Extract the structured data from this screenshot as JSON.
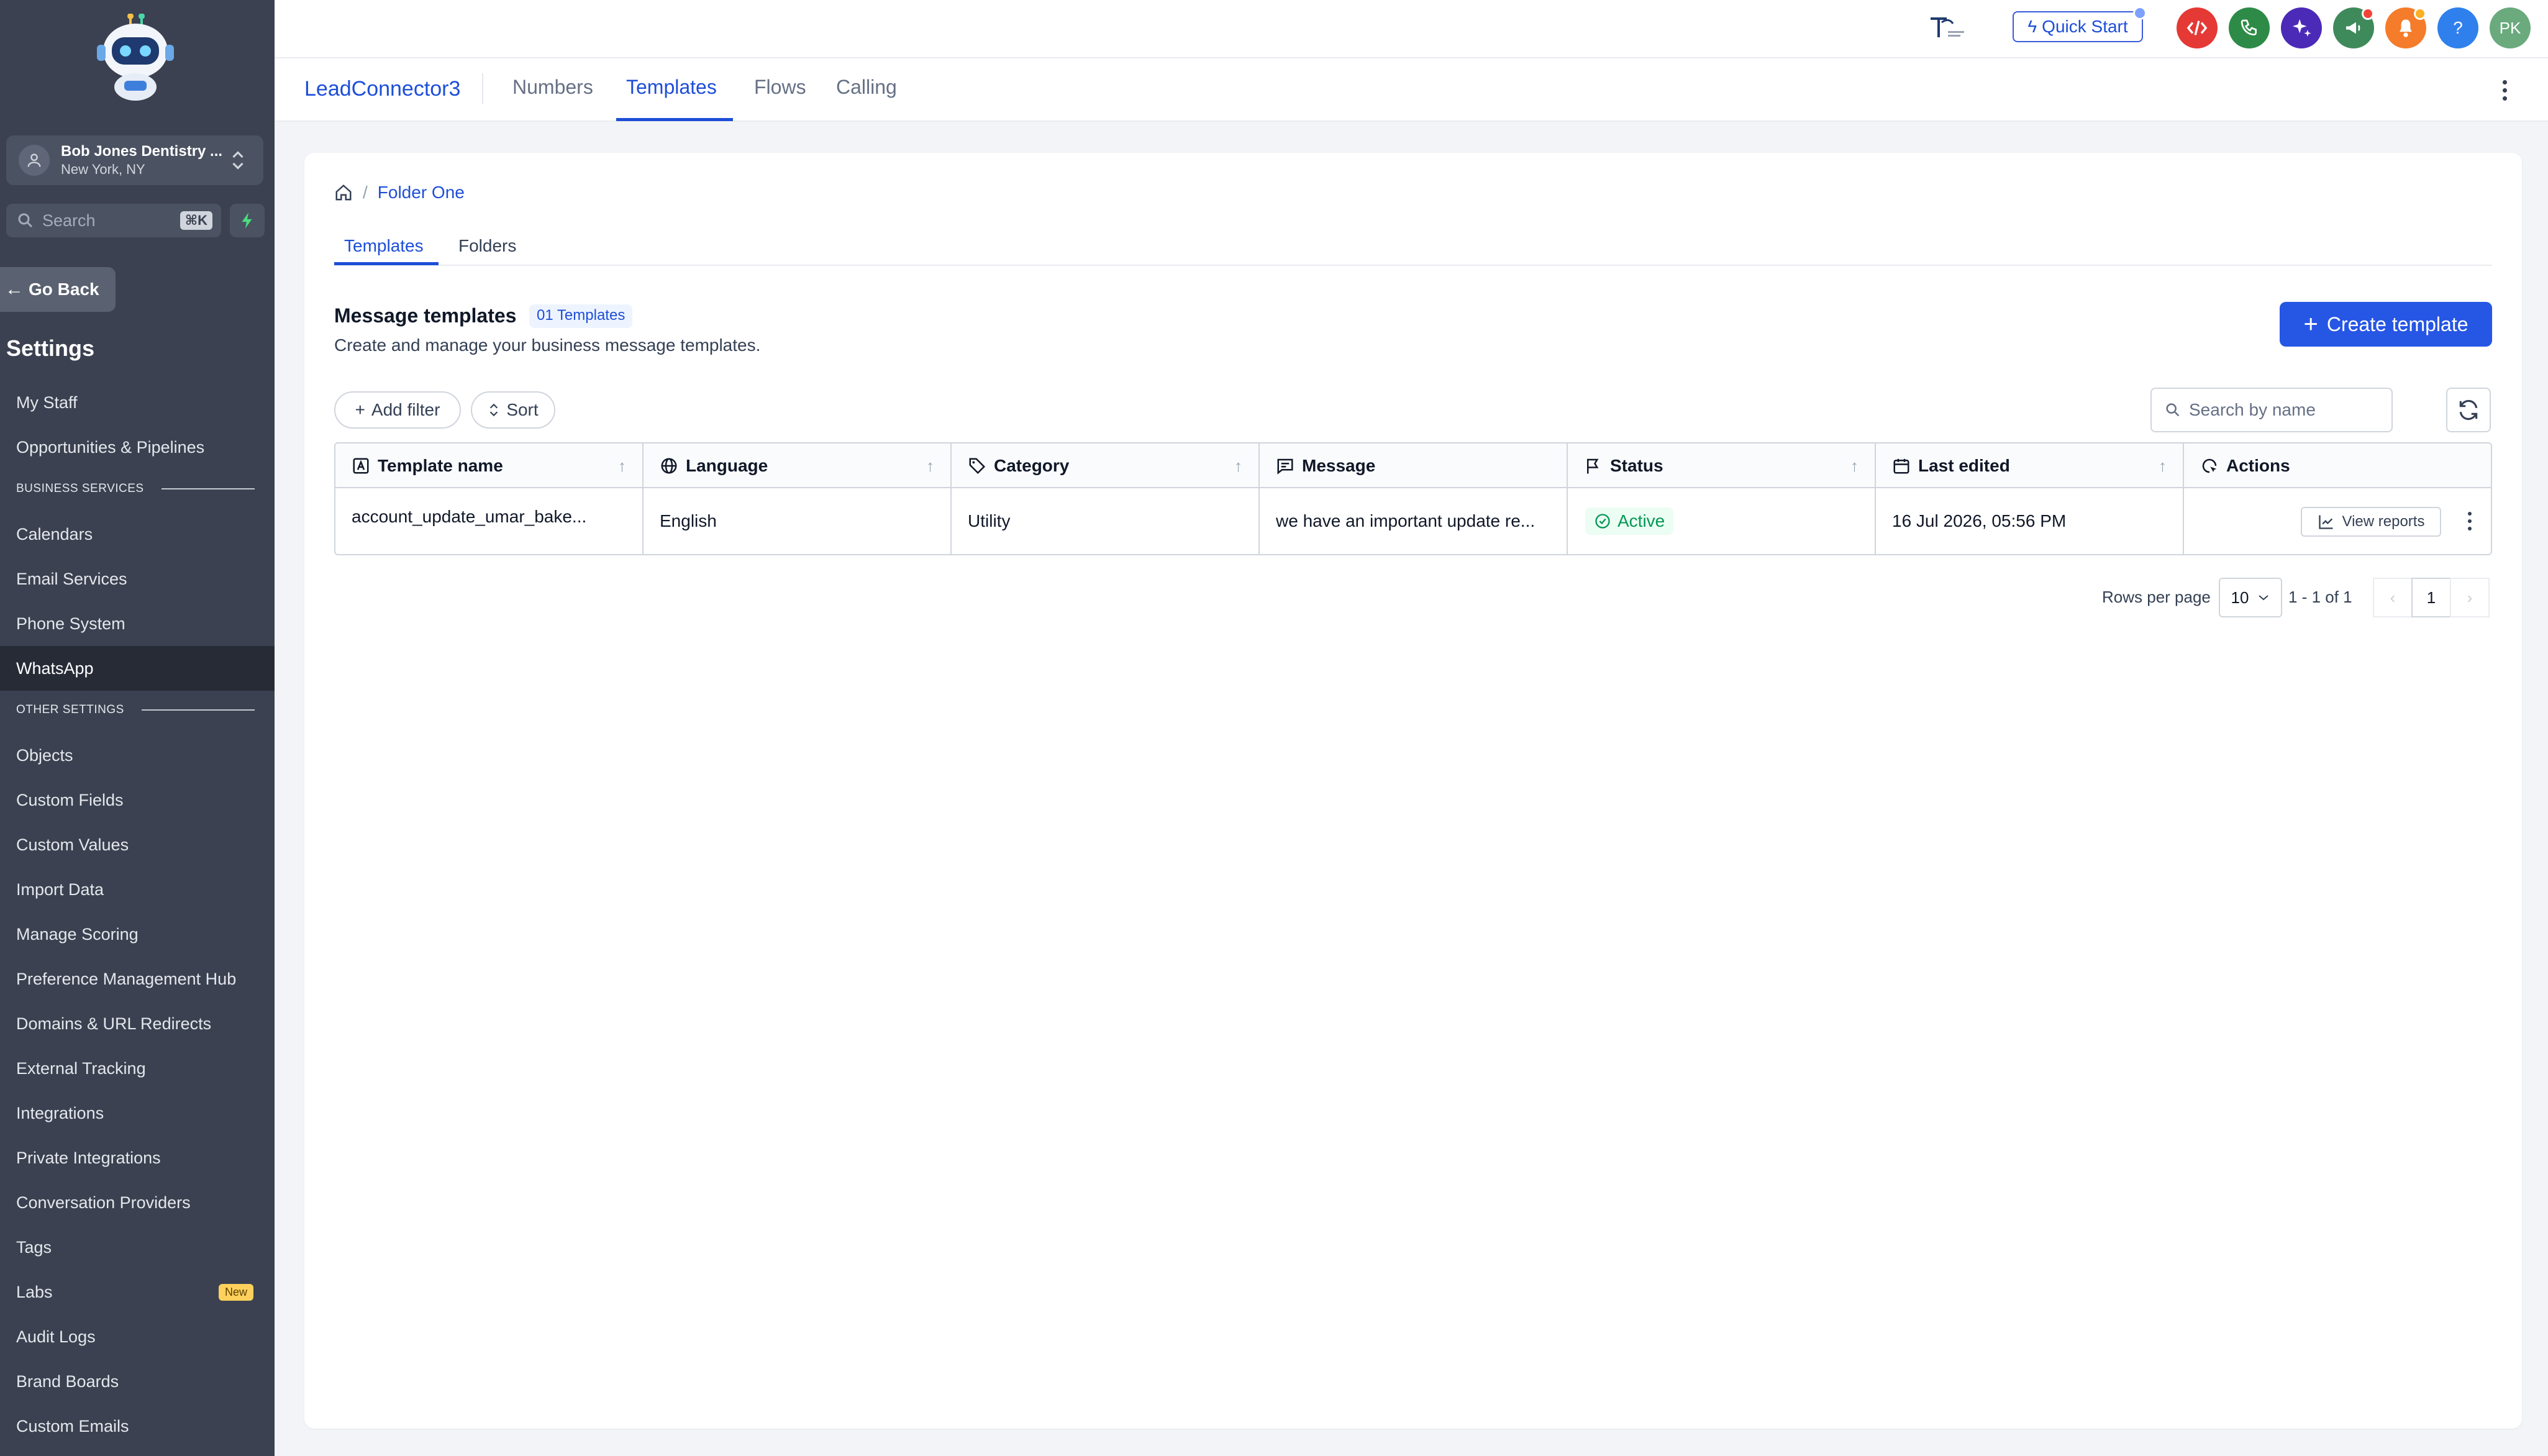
{
  "sidebar": {
    "account": {
      "name": "Bob Jones Dentistry ...",
      "location": "New York, NY"
    },
    "search": {
      "placeholder": "Search",
      "shortcut": "⌘K"
    },
    "go_back": "Go Back",
    "settings_title": "Settings",
    "items_top": [
      "My Staff",
      "Opportunities & Pipelines"
    ],
    "section_business": "BUSINESS SERVICES",
    "items_business": [
      "Calendars",
      "Email Services",
      "Phone System",
      "WhatsApp"
    ],
    "section_other": "OTHER SETTINGS",
    "items_other": [
      "Objects",
      "Custom Fields",
      "Custom Values",
      "Import Data",
      "Manage Scoring",
      "Preference Management Hub",
      "Domains & URL Redirects",
      "External Tracking",
      "Integrations",
      "Private Integrations",
      "Conversation Providers",
      "Tags",
      "Labs",
      "Audit Logs",
      "Brand Boards",
      "Custom Emails"
    ],
    "labs_badge": "New",
    "active_item": "WhatsApp"
  },
  "topbar": {
    "quick_start": "Quick Start",
    "avatar_initials": "PK",
    "help": "?",
    "colors": {
      "code": "#e53935",
      "phone": "#2e8b47",
      "ai": "#4c2ab8",
      "megaphone": "#3f8a5a",
      "bell": "#f57c2a",
      "help": "#2f80ed",
      "avatar": "#6aaa7c"
    }
  },
  "subnav": {
    "app_name": "LeadConnector3",
    "tabs": [
      "Numbers",
      "Templates",
      "Flows",
      "Calling"
    ],
    "active_tab": "Templates"
  },
  "main": {
    "breadcrumb": {
      "sep": "/",
      "folder": "Folder One"
    },
    "tabs": [
      "Templates",
      "Folders"
    ],
    "title": "Message templates",
    "count_badge": "01 Templates",
    "description": "Create and manage your business message templates.",
    "create_button": "Create template",
    "add_filter": "Add filter",
    "sort": "Sort",
    "search_placeholder": "Search by name",
    "table": {
      "columns": [
        "Template name",
        "Language",
        "Category",
        "Message",
        "Status",
        "Last edited",
        "Actions"
      ],
      "rows": [
        {
          "template_name": "account_update_umar_bake...",
          "language": "English",
          "category": "Utility",
          "message": "we have an important update re...",
          "status": "Active",
          "last_edited": "16 Jul 2026, 05:56 PM",
          "action": "View reports"
        }
      ]
    },
    "pagination": {
      "rows_label": "Rows per page",
      "rows_value": "10",
      "range": "1 - 1 of 1",
      "page": "1"
    }
  }
}
